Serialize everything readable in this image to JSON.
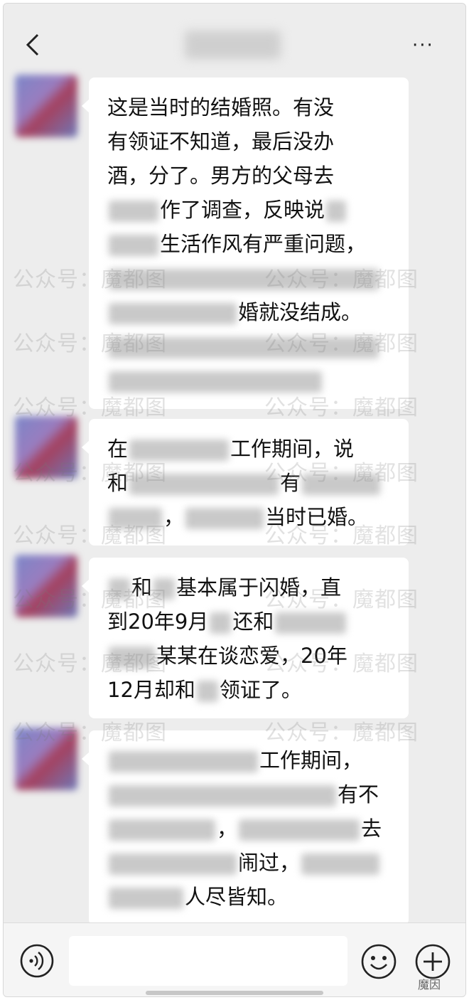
{
  "header": {
    "title_blurred": "",
    "back_label": "",
    "more_label": "···"
  },
  "watermark": {
    "text": "公众号：魔都图"
  },
  "messages": [
    {
      "lines": [
        {
          "parts": [
            {
              "t": "这是当时的结婚照。有没"
            }
          ]
        },
        {
          "parts": [
            {
              "t": "有领证不知道，最后没办"
            }
          ]
        },
        {
          "parts": [
            {
              "t": "酒，分了。男方的父母去"
            }
          ]
        },
        {
          "parts": [
            {
              "b": 70
            },
            {
              "t": "作了调查，反映说"
            },
            {
              "b": 28
            }
          ]
        },
        {
          "parts": [
            {
              "b": 70
            },
            {
              "t": "生活作风有严重问题，"
            }
          ]
        },
        {
          "parts": [
            {
              "b": 380
            }
          ]
        },
        {
          "parts": [
            {
              "b": 180
            },
            {
              "t": "婚就没结成。"
            }
          ]
        },
        {
          "parts": [
            {
              "b": 380
            }
          ]
        },
        {
          "parts": [
            {
              "b": 300
            }
          ]
        }
      ]
    },
    {
      "lines": [
        {
          "parts": [
            {
              "t": "在"
            },
            {
              "b": 140
            },
            {
              "t": "工作期间，说"
            }
          ]
        },
        {
          "parts": [
            {
              "t": "和"
            },
            {
              "b": 210
            },
            {
              "t": "有"
            },
            {
              "b": 110
            }
          ]
        },
        {
          "parts": [
            {
              "b": 75
            },
            {
              "t": "，"
            },
            {
              "b": 110
            },
            {
              "t": "当时已婚。"
            }
          ]
        }
      ]
    },
    {
      "lines": [
        {
          "parts": [
            {
              "b": 30
            },
            {
              "t": "和"
            },
            {
              "b": 30
            },
            {
              "t": "基本属于闪婚，直"
            }
          ]
        },
        {
          "parts": [
            {
              "t": "到20年9月"
            },
            {
              "b": 30
            },
            {
              "t": "还和"
            },
            {
              "b": 100
            }
          ]
        },
        {
          "parts": [
            {
              "b": 65
            },
            {
              "t": "某某在谈恋爱，20年"
            }
          ]
        },
        {
          "parts": [
            {
              "t": "12月却和"
            },
            {
              "b": 30
            },
            {
              "t": "领证了。"
            }
          ]
        }
      ]
    },
    {
      "lines": [
        {
          "parts": [
            {
              "b": 210
            },
            {
              "t": "工作期间，"
            }
          ]
        },
        {
          "parts": [
            {
              "b": 320
            },
            {
              "t": "有不"
            }
          ]
        },
        {
          "parts": [
            {
              "b": 150
            },
            {
              "t": "，"
            },
            {
              "b": 170
            },
            {
              "t": "去"
            }
          ]
        },
        {
          "parts": [
            {
              "b": 180
            },
            {
              "t": "闹过，"
            },
            {
              "b": 110
            }
          ]
        },
        {
          "parts": [
            {
              "b": 105
            },
            {
              "t": "人尽皆知。"
            }
          ]
        }
      ]
    }
  ],
  "input_bar": {
    "placeholder": ""
  },
  "brand": {
    "logo_text": "魔因"
  }
}
